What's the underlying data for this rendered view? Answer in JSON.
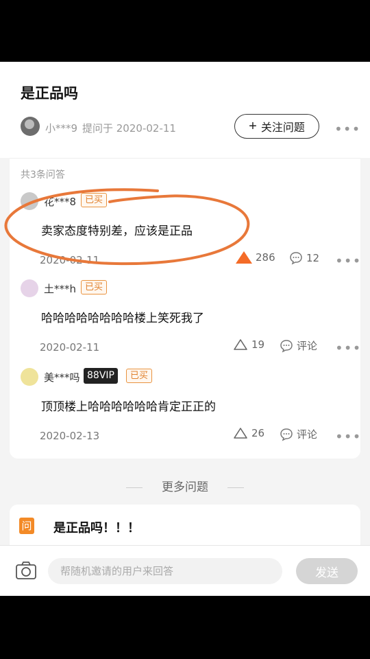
{
  "question": {
    "title": "是正品吗",
    "asker": "小***9",
    "asked_meta": "提问于 2020-02-11",
    "follow_label": "关注问题",
    "follow_icon": "plus-icon"
  },
  "answers_count": "共3条问答",
  "answers": [
    {
      "user": "花***8",
      "bought": "已买",
      "text": "卖家态度特别差，应该是正品",
      "date": "2020-02-11",
      "likes": "286",
      "comments": "12"
    },
    {
      "user": "土***h",
      "bought": "已买",
      "text": "哈哈哈哈哈哈哈哈楼上笑死我了",
      "date": "2020-02-11",
      "likes": "19",
      "comments": "评论"
    },
    {
      "user": "美***吗",
      "vip": "88VIP",
      "bought": "已买",
      "text": "顶顶楼上哈哈哈哈哈哈肯定正正的",
      "date": "2020-02-13",
      "likes": "26",
      "comments": "评论"
    }
  ],
  "more_questions": "更多问题",
  "next_question": {
    "icon_label": "问",
    "title": "是正品吗！！！"
  },
  "reply": {
    "placeholder": "帮随机邀请的用户来回答",
    "send_label": "发送"
  },
  "colors": {
    "accent": "#f46b27",
    "badge": "#e0822f",
    "annotation_circle": "#e8783a"
  }
}
